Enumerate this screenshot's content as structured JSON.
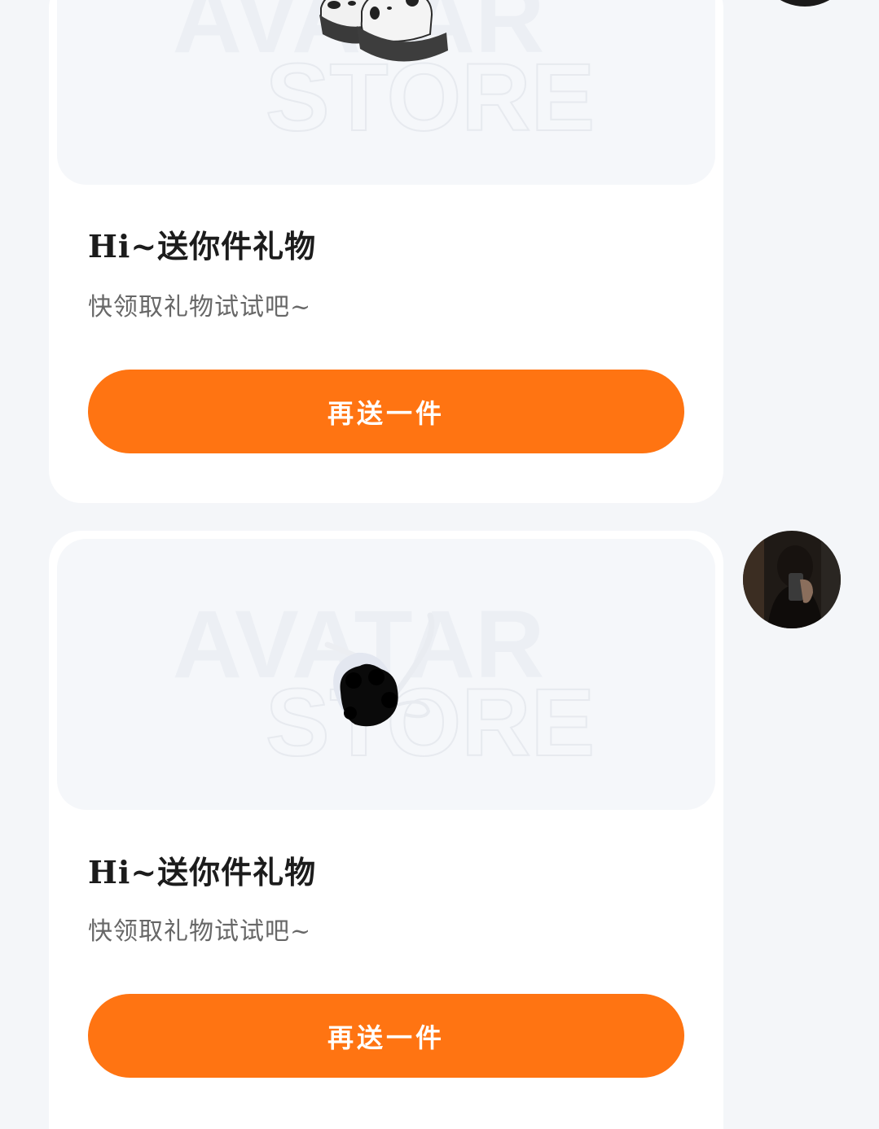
{
  "watermark": {
    "line1": "AVATAR",
    "line2": "STORE"
  },
  "messages": [
    {
      "item_icon": "panda-slippers-icon",
      "title": "Hi~送你件礼物",
      "subtitle": "快领取礼物试试吧~",
      "button_label": "再送一件"
    },
    {
      "item_icon": "black-rose-bouquet-icon",
      "title": "Hi~送你件礼物",
      "subtitle": "快领取礼物试试吧~",
      "button_label": "再送一件"
    }
  ],
  "colors": {
    "accent": "#ff7412",
    "page_background": "#f4f6f9",
    "card_background": "#ffffff",
    "preview_background": "#f5f7fa"
  }
}
